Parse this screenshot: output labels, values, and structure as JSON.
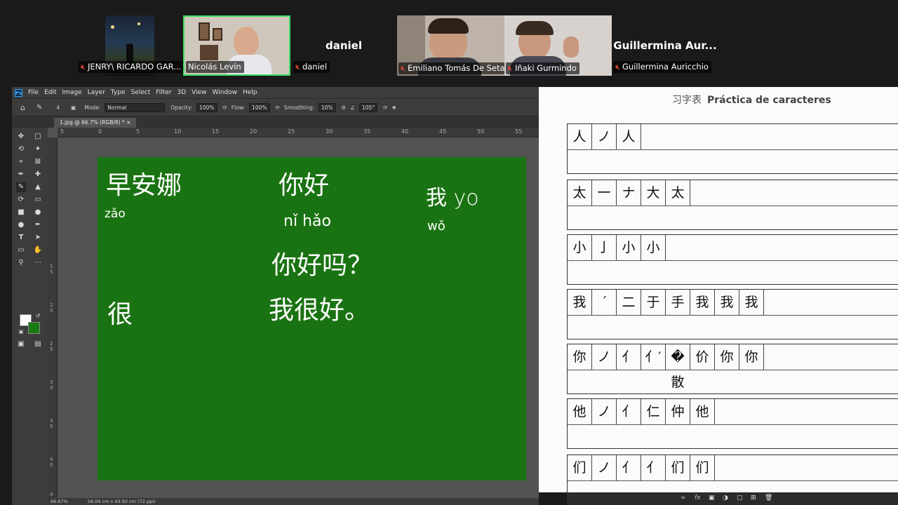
{
  "participants": [
    {
      "name": "JENRY\\ RICARDO GAR...",
      "muted": true
    },
    {
      "name": "Nicolás Levín",
      "muted": false,
      "active_speaker": true
    },
    {
      "name": "daniel",
      "muted": true,
      "video_off": true
    },
    {
      "name": "Emiliano Tomás De Seta",
      "muted": true
    },
    {
      "name": "Iñaki Gurmindo",
      "muted": true
    },
    {
      "name": "Guillermina Auricchio",
      "muted": true,
      "video_off": true,
      "display_name": "Guillermina Aur..."
    }
  ],
  "photoshop": {
    "logo": "Ps",
    "menu": [
      "File",
      "Edit",
      "Image",
      "Layer",
      "Type",
      "Select",
      "Filter",
      "3D",
      "View",
      "Window",
      "Help"
    ],
    "options": {
      "brush_size": "4",
      "mode_label": "Mode:",
      "mode_value": "Normal",
      "opacity_label": "Opacity:",
      "opacity_value": "100%",
      "flow_label": "Flow:",
      "flow_value": "100%",
      "smoothing_label": "Smoothing:",
      "smoothing_value": "10%",
      "angle_value": "105°"
    },
    "document_tab": "1.jpg @ 66.7% (RGB/8) *",
    "ruler_ticks": [
      "5",
      "0",
      "5",
      "10",
      "15",
      "20",
      "25",
      "30",
      "35",
      "40",
      "45",
      "50",
      "55"
    ],
    "ruler_ticks_v": [
      "1 5",
      "2 0",
      "2 5",
      "3 0",
      "3 5",
      "4 0",
      "4 5"
    ],
    "status": {
      "zoom": "66.67%",
      "size": "56.04 cm x 43.92 cm (72 ppi)"
    },
    "colors": {
      "foreground": "#ffffff",
      "background": "#1a7a12",
      "canvas": "#1a7312"
    },
    "handwriting": [
      {
        "text": "早安娜"
      },
      {
        "text": "zǎo"
      },
      {
        "text": "你好"
      },
      {
        "text": "nǐ hǎo"
      },
      {
        "text": "我 yo"
      },
      {
        "text": "wǒ"
      },
      {
        "text": "你好吗？"
      },
      {
        "text": "很"
      },
      {
        "text": "我很好。"
      }
    ]
  },
  "worksheet": {
    "title_cn": "习字表",
    "title_es": "Práctica de caracteres",
    "rows": [
      [
        "人",
        "ノ",
        "人"
      ],
      [
        "太",
        "一",
        "ナ",
        "大",
        "太"
      ],
      [
        "小",
        "亅",
        "小",
        "小"
      ],
      [
        "我",
        "ˊ",
        "二",
        "于",
        "手",
        "我",
        "我",
        "我"
      ],
      [
        "你",
        "ノ",
        "亻",
        "亻′",
        "�散",
        "价",
        "你",
        "你"
      ],
      [
        "他",
        "ノ",
        "亻",
        "仁",
        "仲",
        "他"
      ],
      [
        "们",
        "ノ",
        "亻",
        "亻",
        "们",
        "们"
      ]
    ]
  }
}
